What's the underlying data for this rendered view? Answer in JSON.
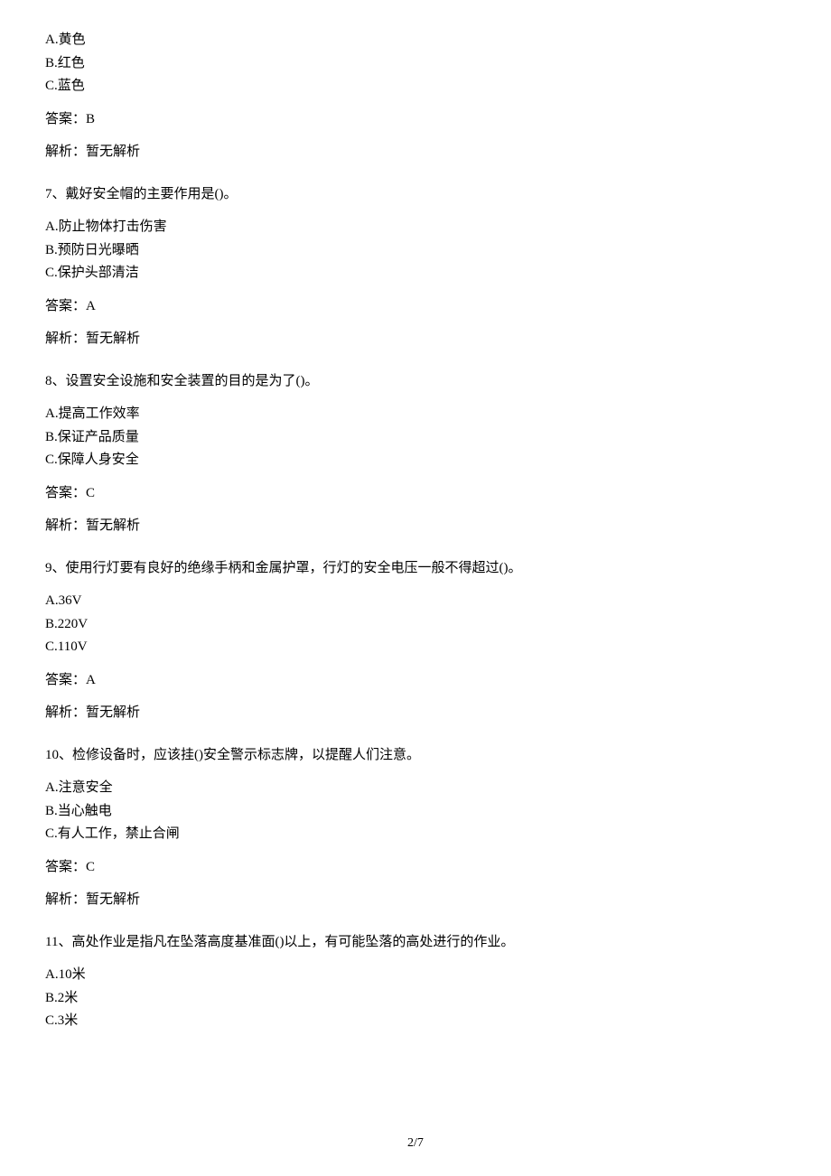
{
  "q6": {
    "optA": "A.黄色",
    "optB": "B.红色",
    "optC": "C.蓝色",
    "answer": "答案：B",
    "analysis": "解析：暂无解析"
  },
  "q7": {
    "question": "7、戴好安全帽的主要作用是()。",
    "optA": "A.防止物体打击伤害",
    "optB": "B.预防日光曝晒",
    "optC": "C.保护头部清洁",
    "answer": "答案：A",
    "analysis": "解析：暂无解析"
  },
  "q8": {
    "question": "8、设置安全设施和安全装置的目的是为了()。",
    "optA": "A.提高工作效率",
    "optB": "B.保证产品质量",
    "optC": "C.保障人身安全",
    "answer": "答案：C",
    "analysis": "解析：暂无解析"
  },
  "q9": {
    "question": "9、使用行灯要有良好的绝缘手柄和金属护罩，行灯的安全电压一般不得超过()。",
    "optA": "A.36V",
    "optB": "B.220V",
    "optC": "C.110V",
    "answer": "答案：A",
    "analysis": "解析：暂无解析"
  },
  "q10": {
    "question": "10、检修设备时，应该挂()安全警示标志牌，以提醒人们注意。",
    "optA": "A.注意安全",
    "optB": "B.当心触电",
    "optC": "C.有人工作，禁止合闸",
    "answer": "答案：C",
    "analysis": "解析：暂无解析"
  },
  "q11": {
    "question": "11、高处作业是指凡在坠落高度基准面()以上，有可能坠落的高处进行的作业。",
    "optA": "A.10米",
    "optB": "B.2米",
    "optC": "C.3米"
  },
  "footer": "2/7"
}
